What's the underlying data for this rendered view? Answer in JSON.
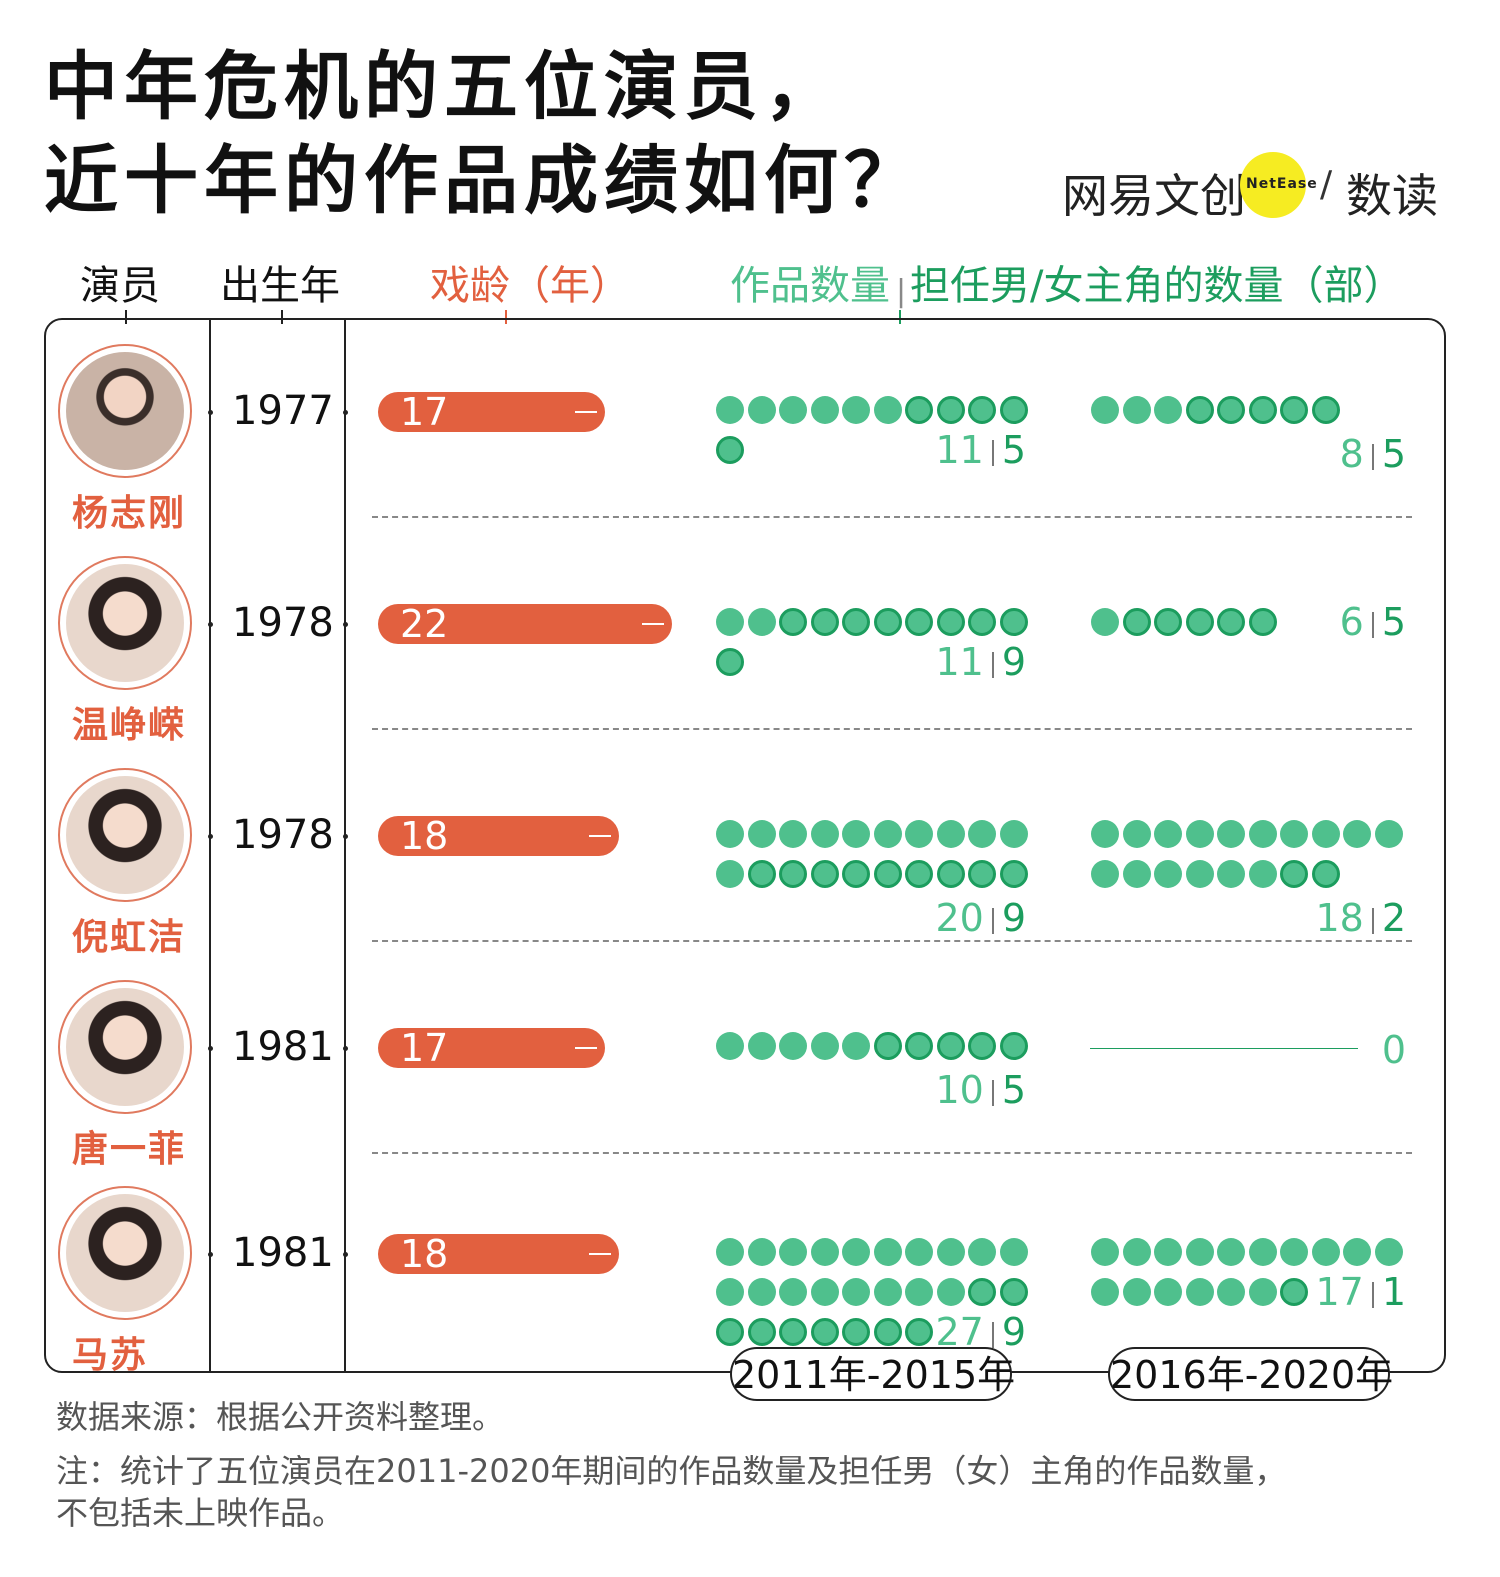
{
  "title": {
    "line1": "中年危机的五位演员，",
    "line2": "近十年的作品成绩如何？"
  },
  "brand": {
    "left": "网易文创",
    "badge": "NetEase",
    "slash": "/",
    "right": "数读"
  },
  "headers": {
    "actor": "演员",
    "birth_year": "出生年",
    "career": "戏龄（年）",
    "works": "作品数量",
    "leads": "担任男/女主角的数量（部）"
  },
  "colors": {
    "accent": "#e2603f",
    "works": "#4fc08d",
    "leads": "#1c9d5e"
  },
  "periods": [
    "2011年-2015年",
    "2016年-2020年"
  ],
  "chart_data": {
    "type": "table",
    "columns": [
      "演员",
      "出生年",
      "戏龄（年）",
      "2011年-2015年 作品数量",
      "2011年-2015年 主角数量",
      "2016年-2020年 作品数量",
      "2016年-2020年 主角数量"
    ],
    "rows": [
      {
        "name": "杨志刚",
        "birth_year": "1977",
        "career_years": 17,
        "works_2011_2015": 11,
        "leads_2011_2015": 5,
        "works_2016_2020": 8,
        "leads_2016_2020": 5
      },
      {
        "name": "温峥嵘",
        "birth_year": "1978",
        "career_years": 22,
        "works_2011_2015": 11,
        "leads_2011_2015": 9,
        "works_2016_2020": 6,
        "leads_2016_2020": 5
      },
      {
        "name": "倪虹洁",
        "birth_year": "1978",
        "career_years": 18,
        "works_2011_2015": 20,
        "leads_2011_2015": 9,
        "works_2016_2020": 18,
        "leads_2016_2020": 2
      },
      {
        "name": "唐一菲",
        "birth_year": "1981",
        "career_years": 17,
        "works_2011_2015": 10,
        "leads_2011_2015": 5,
        "works_2016_2020": 0,
        "leads_2016_2020": 0
      },
      {
        "name": "马苏",
        "birth_year": "1981",
        "career_years": 18,
        "works_2011_2015": 27,
        "leads_2011_2015": 9,
        "works_2016_2020": 17,
        "leads_2016_2020": 1
      }
    ]
  },
  "footer": {
    "source": "数据来源：根据公开资料整理。",
    "note1": "注：统计了五位演员在2011-2020年期间的作品数量及担任男（女）主角的作品数量，",
    "note2": "不包括未上映作品。"
  }
}
